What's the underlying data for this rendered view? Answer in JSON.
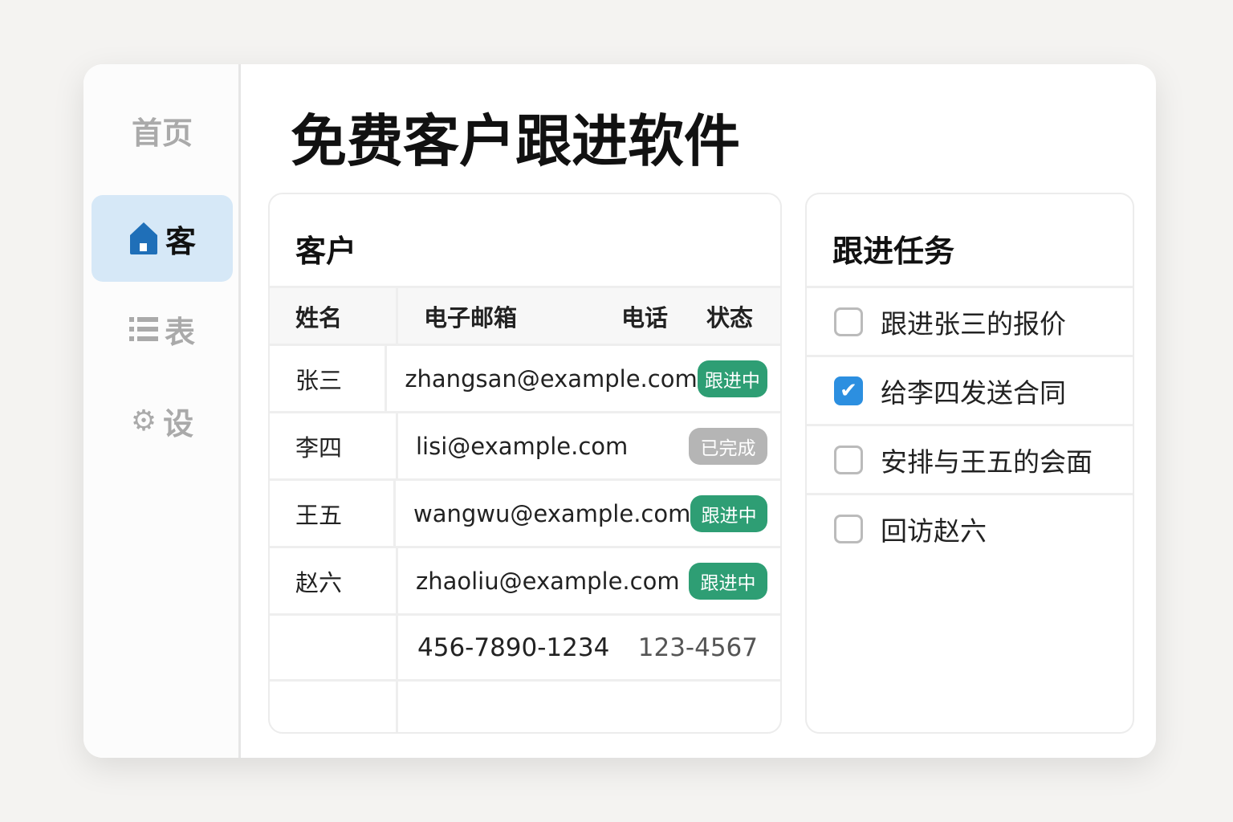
{
  "sidebar": {
    "items": [
      {
        "label": "首页",
        "icon": "none"
      },
      {
        "label": "客",
        "icon": "home-icon",
        "active": true
      },
      {
        "label": "表",
        "icon": "list-icon"
      },
      {
        "label": "设",
        "icon": "gear-icon"
      }
    ]
  },
  "title": "免费客户跟进软件",
  "customers": {
    "title": "客户",
    "headers": [
      "姓名",
      "电子邮箱",
      "电话",
      "状态"
    ],
    "rows": [
      {
        "name": "张三",
        "email": "zhangsan@example.com",
        "status": "跟进中"
      },
      {
        "name": "李四",
        "email": "lisi@example.com",
        "status": "已完成"
      },
      {
        "name": "王五",
        "email": "wangwu@example.com",
        "status": "跟进中"
      },
      {
        "name": "赵六",
        "email": "zhaoliu@example.com",
        "status": "跟进中"
      }
    ],
    "extra": {
      "phone1": "456-7890-1234",
      "phone2": "123-4567"
    }
  },
  "tasks": {
    "title": "跟进任务",
    "items": [
      {
        "label": "跟进张三的报价",
        "checked": false
      },
      {
        "label": "给李四发送合同",
        "checked": true
      },
      {
        "label": "安排与王五的会面",
        "checked": false
      },
      {
        "label": "回访赵六",
        "checked": false
      }
    ]
  },
  "colors": {
    "accent": "#2c8fe0",
    "progress": "#2e9e74",
    "done": "#b5b5b5"
  }
}
